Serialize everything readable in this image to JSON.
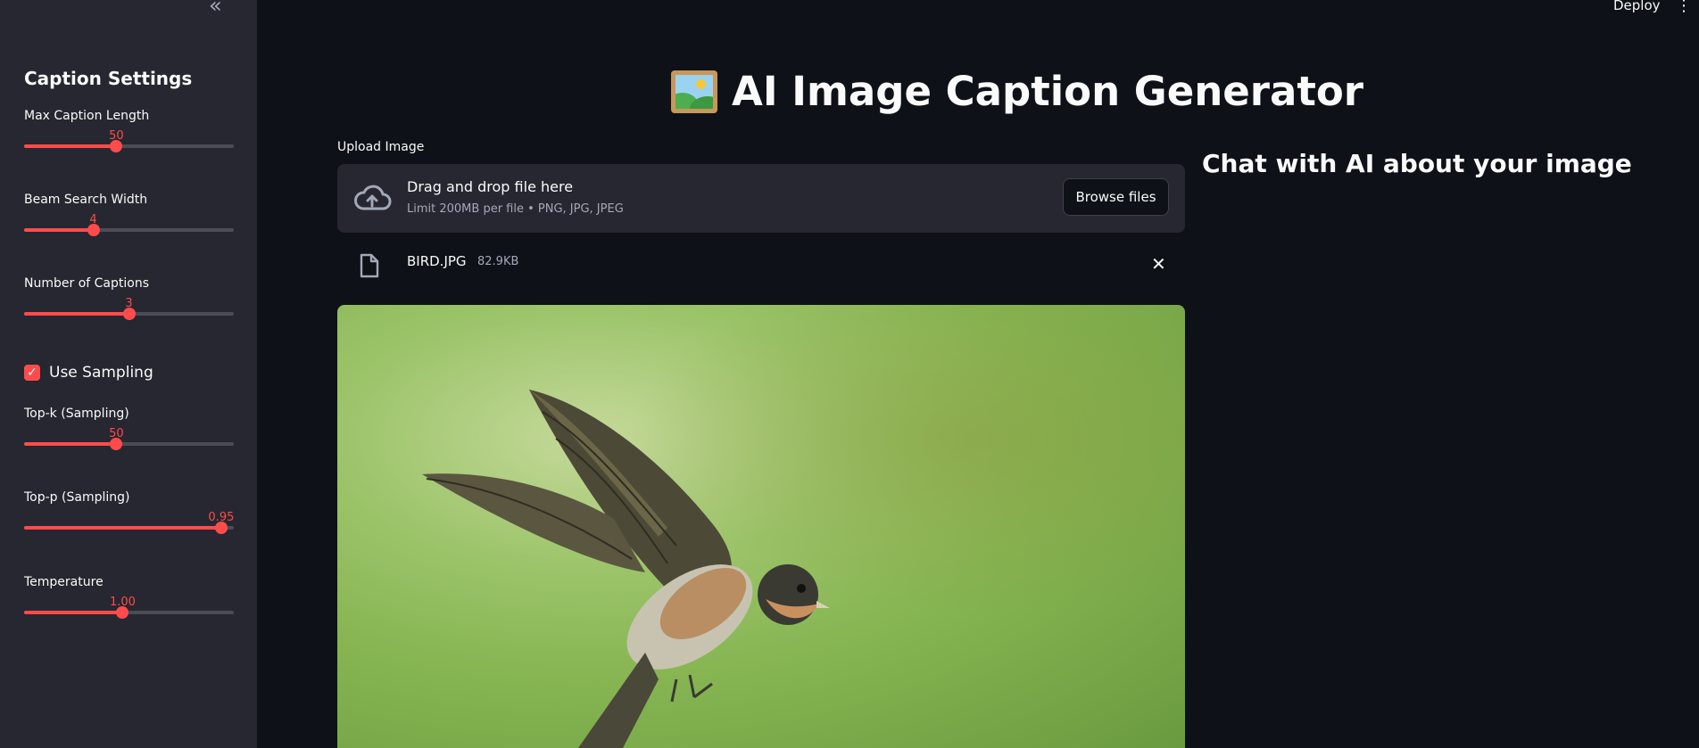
{
  "sidebar": {
    "collapse_icon": "double-chevron-left-icon",
    "title": "Caption Settings",
    "sliders": [
      {
        "label": "Max Caption Length",
        "value": "50",
        "fraction": 0.44
      },
      {
        "label": "Beam Search Width",
        "value": "4",
        "fraction": 0.33
      },
      {
        "label": "Number of Captions",
        "value": "3",
        "fraction": 0.5
      },
      {
        "label": "Top-k (Sampling)",
        "value": "50",
        "fraction": 0.44
      },
      {
        "label": "Top-p (Sampling)",
        "value": "0.95",
        "fraction": 0.94
      },
      {
        "label": "Temperature",
        "value": "1.00",
        "fraction": 0.47
      }
    ],
    "checkbox": {
      "label": "Use Sampling",
      "checked": true
    }
  },
  "header": {
    "deploy_label": "Deploy",
    "menu_icon": "vertical-dots-icon"
  },
  "main": {
    "title": "AI Image Caption Generator",
    "title_icon": "framed-picture-icon",
    "upload_label": "Upload Image",
    "dropzone": {
      "title": "Drag and drop file here",
      "subtitle": "Limit 200MB per file • PNG, JPG, JPEG",
      "browse_label": "Browse files",
      "icon": "cloud-upload-icon"
    },
    "file": {
      "name": "BIRD.JPG",
      "size": "82.9KB",
      "icon": "file-icon"
    },
    "chat_title": "Chat with AI about your image"
  },
  "colors": {
    "accent": "#ff4b4b",
    "background": "#0e1117",
    "sidebar": "#262730"
  }
}
